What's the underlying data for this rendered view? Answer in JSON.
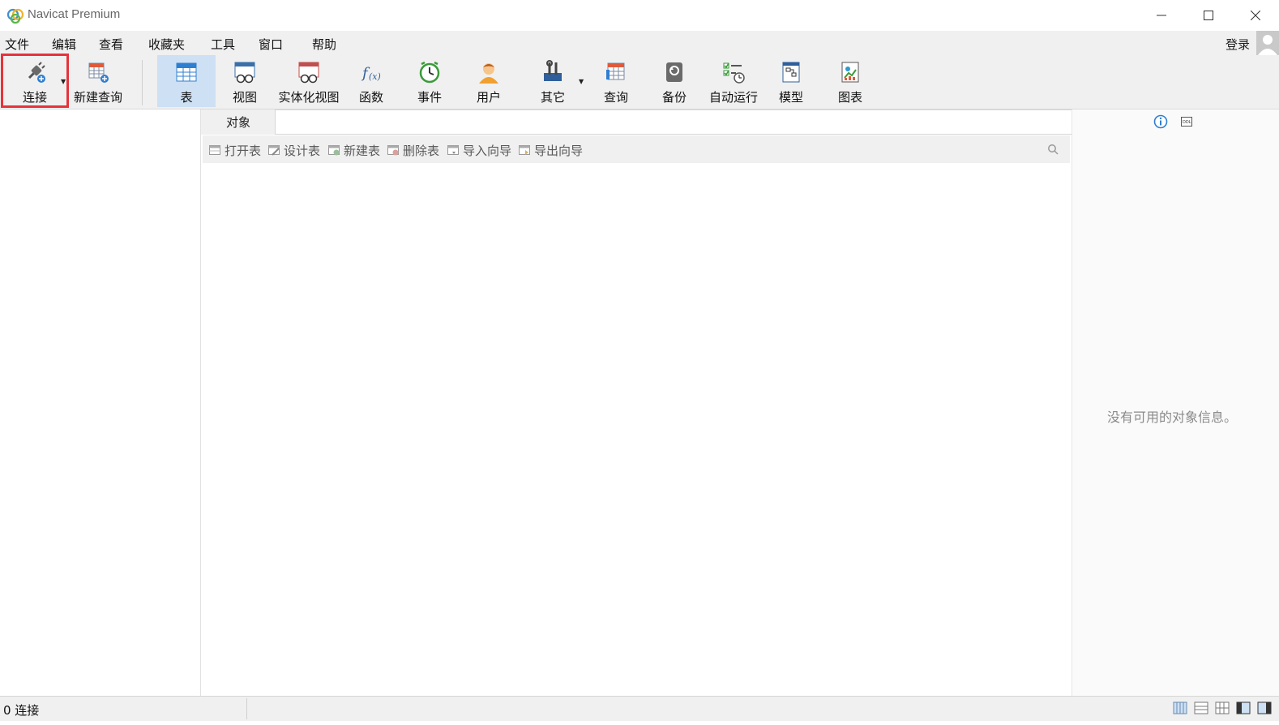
{
  "window": {
    "title": "Navicat Premium"
  },
  "menu": {
    "items": [
      "文件",
      "编辑",
      "查看",
      "收藏夹",
      "工具",
      "窗口",
      "帮助"
    ],
    "login": "登录"
  },
  "toolbar": {
    "connect": "连接",
    "new_query": "新建查询",
    "table": "表",
    "view": "视图",
    "mat_view": "实体化视图",
    "function": "函数",
    "event": "事件",
    "user": "用户",
    "other": "其它",
    "query": "查询",
    "backup": "备份",
    "auto_run": "自动运行",
    "model": "模型",
    "chart": "图表"
  },
  "tabs": {
    "objects": "对象"
  },
  "object_toolbar": {
    "open_table": "打开表",
    "design_table": "设计表",
    "new_table": "新建表",
    "delete_table": "删除表",
    "import_wizard": "导入向导",
    "export_wizard": "导出向导"
  },
  "info_panel": {
    "empty_message": "没有可用的对象信息。"
  },
  "status": {
    "connections": "0 连接"
  },
  "colors": {
    "highlight": "#e6333c",
    "active_tab": "#cde0f4",
    "accent_blue": "#2f7fd1"
  }
}
